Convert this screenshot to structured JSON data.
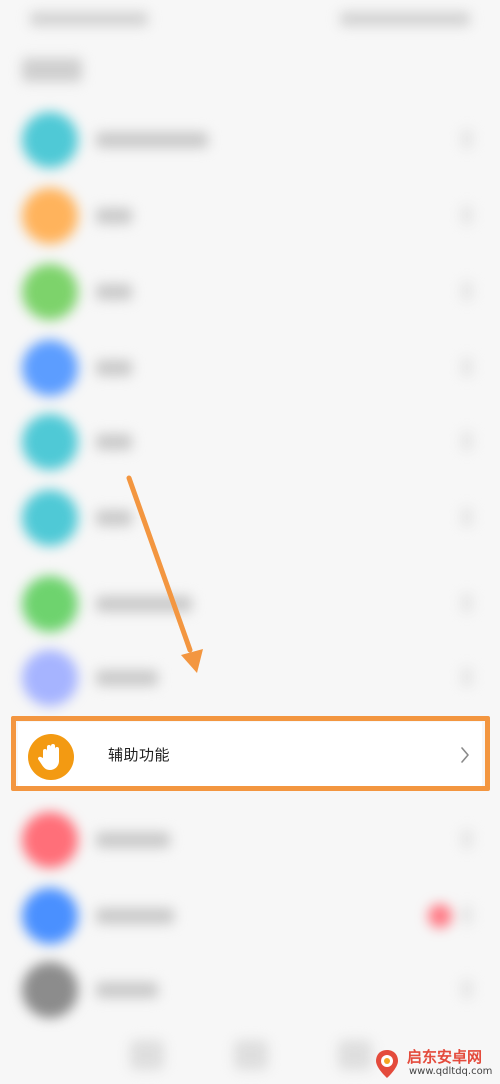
{
  "focus_item": {
    "label": "辅助功能",
    "icon": "hand-icon",
    "icon_color": "#F39A12"
  },
  "annotation": {
    "box_color": "#F39640",
    "arrow_color": "#F39640"
  },
  "blurred_rows": [
    {
      "icon_color": "#4FC9D6"
    },
    {
      "icon_color": "#FFB35C"
    },
    {
      "icon_color": "#7DD36B"
    },
    {
      "icon_color": "#5C9DFF"
    },
    {
      "icon_color": "#4FC9D6"
    },
    {
      "icon_color": "#4FC9D6"
    },
    {
      "icon_color": "#6ED36E"
    },
    {
      "icon_color": "#A6B4FF"
    },
    {
      "icon_color": "#FF6F79"
    },
    {
      "icon_color": "#4A90FF"
    },
    {
      "icon_color": "#8C8C8C"
    }
  ],
  "watermark": {
    "title": "启东安卓网",
    "url": "www.qdltdq.com"
  }
}
